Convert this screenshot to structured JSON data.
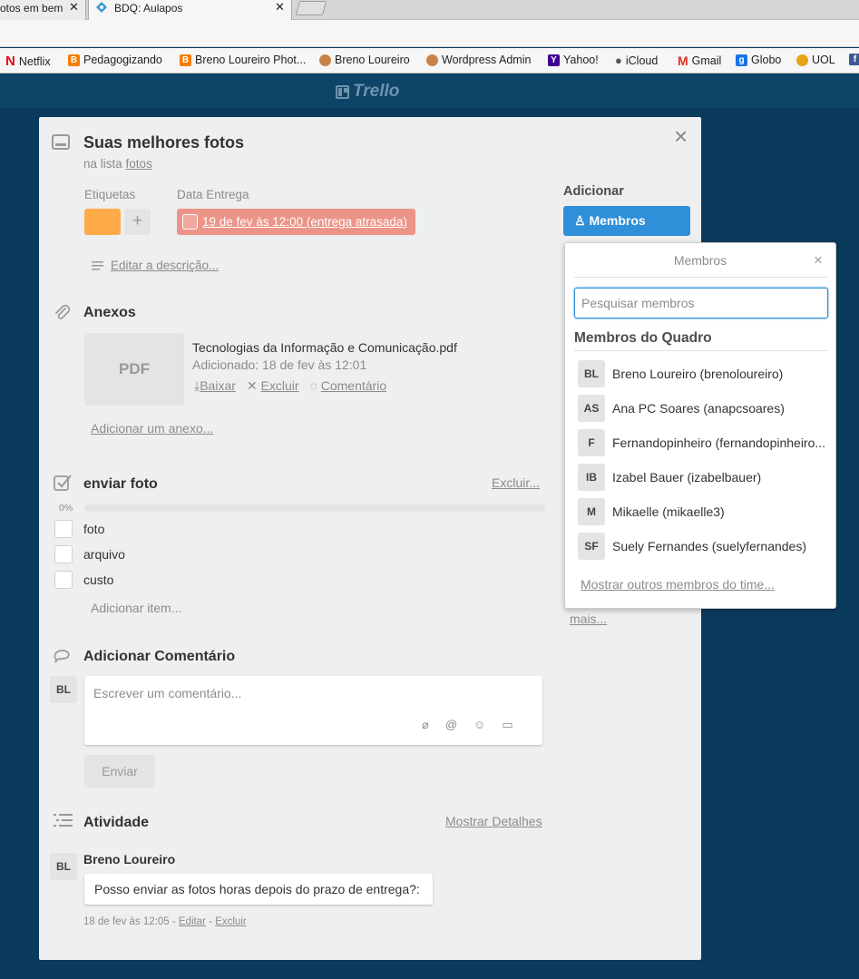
{
  "browser": {
    "tabs": [
      {
        "title": "otos em bem",
        "close": "✕"
      },
      {
        "title": "BDQ: Aulapos",
        "close": "✕"
      }
    ],
    "bookmarks": [
      {
        "label": "Netflix",
        "icon": "netflix-icon",
        "color": "#e50914"
      },
      {
        "label": "Pedagogizando",
        "icon": "blogger-icon",
        "color": "#f57d00"
      },
      {
        "label": "Breno Loureiro Phot...",
        "icon": "blogger-icon",
        "color": "#f57d00"
      },
      {
        "label": "Breno Loureiro",
        "icon": "avatar-icon",
        "color": "#c8834b"
      },
      {
        "label": "Wordpress Admin",
        "icon": "avatar-icon",
        "color": "#c8834b"
      },
      {
        "label": "Yahoo!",
        "icon": "yahoo-icon",
        "color": "#400090"
      },
      {
        "label": "iCloud",
        "icon": "apple-icon",
        "color": "#555555"
      },
      {
        "label": "Gmail",
        "icon": "gmail-icon",
        "color": "#d93025"
      },
      {
        "label": "Globo",
        "icon": "globo-icon",
        "color": "#1a73e8"
      },
      {
        "label": "UOL",
        "icon": "uol-icon",
        "color": "#e8a317"
      }
    ]
  },
  "header": {
    "logo_text": "Trello"
  },
  "card": {
    "title": "Suas melhores fotos",
    "list_prefix": "na lista",
    "list_name": "fotos",
    "labels_heading": "Etiquetas",
    "label_color": "#ffab4a",
    "add_label": "+",
    "due_heading": "Data Entrega",
    "due_text": "19 de fev às 12:00 (entrega atrasada)",
    "description_link": "Editar a descrição...",
    "attachments": {
      "heading": "Anexos",
      "thumb_text": "PDF",
      "file_name": "Tecnologias da Informação e Comunicação.pdf",
      "added": "Adicionado: 18 de fev às 12:01",
      "actions": [
        "Baixar",
        "Excluir",
        "Comentário"
      ],
      "add_link": "Adicionar um anexo..."
    },
    "checklist": {
      "heading": "enviar foto",
      "delete": "Excluir...",
      "progress": "0%",
      "items": [
        "foto",
        "arquivo",
        "custo"
      ],
      "add_item": "Adicionar item..."
    },
    "comment": {
      "heading": "Adicionar Comentário",
      "avatar": "BL",
      "placeholder": "Escrever um comentário...",
      "send": "Enviar"
    },
    "activity": {
      "heading": "Atividade",
      "show_details": "Mostrar Detalhes",
      "author": "Breno Loureiro",
      "avatar": "BL",
      "text": "Posso enviar as fotos horas depois do prazo de entrega?:",
      "time": "18 de fev às 12:05",
      "sep": "-",
      "edit": "Editar",
      "delete": "Excluir"
    },
    "sidebar": {
      "add_heading": "Adicionar",
      "members_button": "Membros",
      "more_link": "mais..."
    }
  },
  "members_popover": {
    "title": "Membros",
    "close": "×",
    "search_placeholder": "Pesquisar membros",
    "board_heading": "Membros do Quadro",
    "members": [
      {
        "initials": "BL",
        "name": "Breno Loureiro (brenoloureiro)"
      },
      {
        "initials": "AS",
        "name": "Ana PC Soares (anapcsoares)"
      },
      {
        "initials": "F",
        "name": "Fernandopinheiro (fernandopinheiro..."
      },
      {
        "initials": "IB",
        "name": "Izabel Bauer (izabelbauer)"
      },
      {
        "initials": "M",
        "name": "Mikaelle (mikaelle3)"
      },
      {
        "initials": "SF",
        "name": "Suely Fernandes (suelyfernandes)"
      }
    ],
    "show_more": "Mostrar outros membros do time..."
  }
}
